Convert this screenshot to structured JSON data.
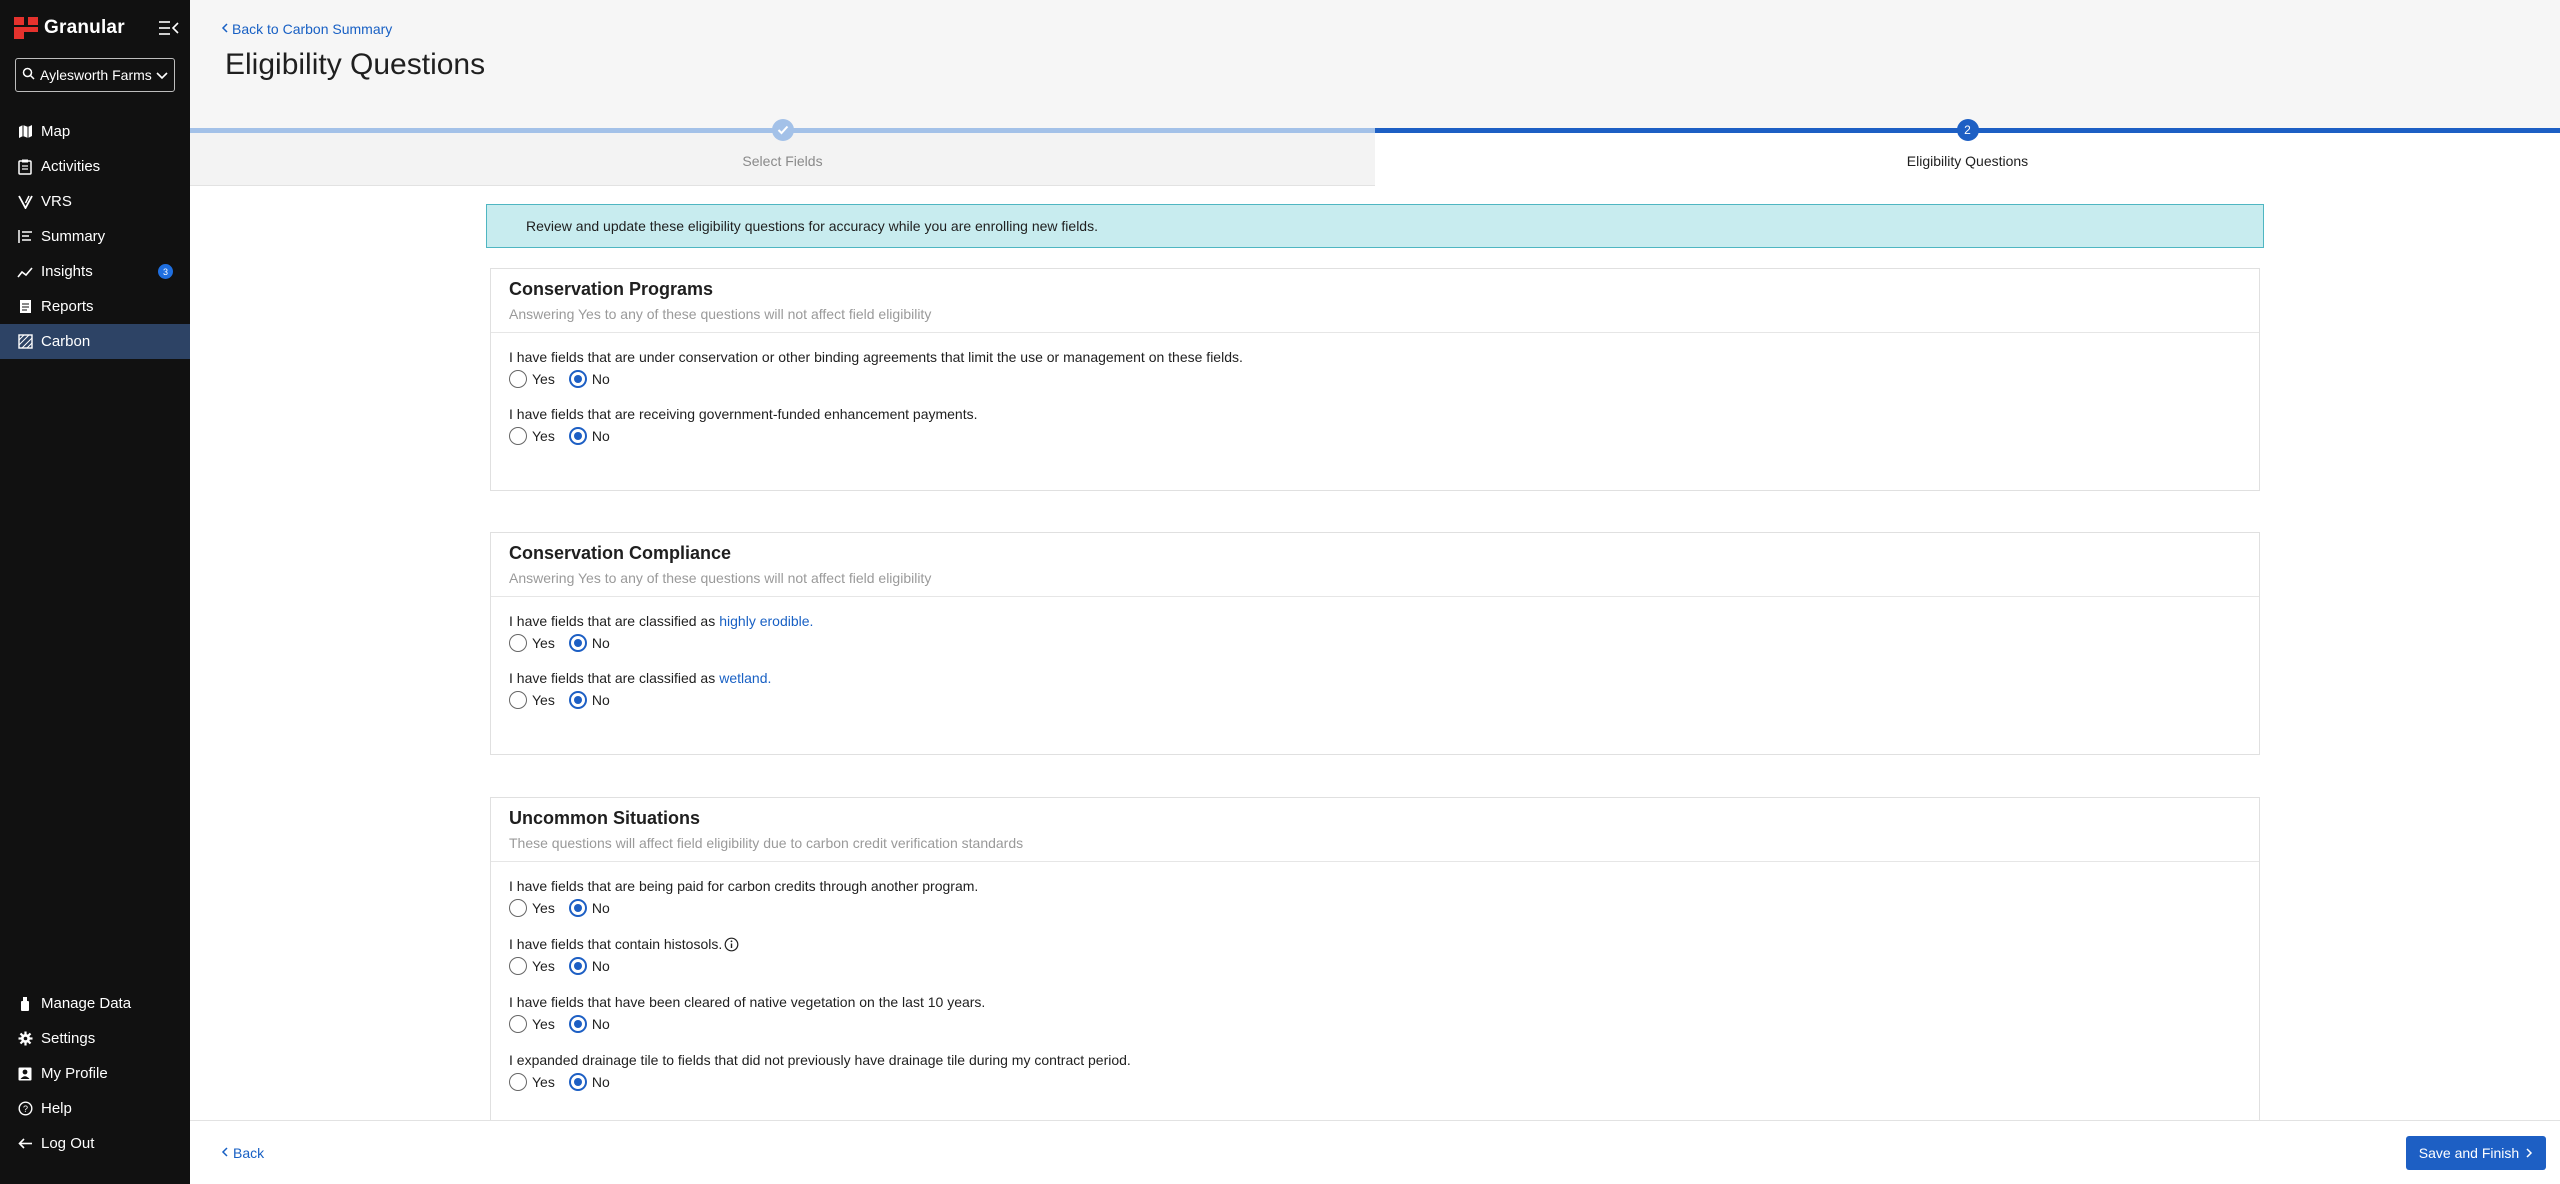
{
  "sidebar": {
    "brand": "Granular",
    "farm_selector": "Aylesworth Farms",
    "items": [
      {
        "label": "Map",
        "icon": "map-icon"
      },
      {
        "label": "Activities",
        "icon": "clipboard-icon"
      },
      {
        "label": "VRS",
        "icon": "vrs-icon"
      },
      {
        "label": "Summary",
        "icon": "summary-icon"
      },
      {
        "label": "Insights",
        "icon": "trend-icon",
        "badge": "3"
      },
      {
        "label": "Reports",
        "icon": "report-icon"
      },
      {
        "label": "Carbon",
        "icon": "carbon-icon",
        "active": true
      }
    ],
    "bottom_items": [
      {
        "label": "Manage Data",
        "icon": "database-icon"
      },
      {
        "label": "Settings",
        "icon": "gear-icon"
      },
      {
        "label": "My Profile",
        "icon": "profile-icon"
      },
      {
        "label": "Help",
        "icon": "help-icon"
      },
      {
        "label": "Log Out",
        "icon": "logout-icon"
      }
    ]
  },
  "header": {
    "back_label": "Back to Carbon Summary",
    "title": "Eligibility Questions"
  },
  "stepper": {
    "steps": [
      {
        "number": "",
        "label": "Select Fields",
        "state": "complete"
      },
      {
        "number": "2",
        "label": "Eligibility Questions",
        "state": "current"
      }
    ]
  },
  "banner": "Review and update these eligibility questions for accuracy while you are enrolling new fields.",
  "radio_labels": {
    "yes": "Yes",
    "no": "No"
  },
  "sections": [
    {
      "title": "Conservation Programs",
      "subtitle": "Answering Yes to any of these questions will not affect field eligibility",
      "questions": [
        {
          "text": "I have fields that are under conservation or other binding agreements that limit the use or management on these fields.",
          "answer": "No"
        },
        {
          "text": "I have fields that are receiving government-funded enhancement payments.",
          "answer": "No"
        }
      ]
    },
    {
      "title": "Conservation Compliance",
      "subtitle": "Answering Yes to any of these questions will not affect field eligibility",
      "questions": [
        {
          "text": "I have fields that are classified as",
          "link": "highly erodible.",
          "answer": "No"
        },
        {
          "text": "I have fields that are classified as",
          "link": "wetland.",
          "answer": "No"
        }
      ]
    },
    {
      "title": "Uncommon Situations",
      "subtitle": "These questions will affect field eligibility due to carbon credit verification standards",
      "questions": [
        {
          "text": "I have fields that are being paid for carbon credits through another program.",
          "answer": "No"
        },
        {
          "text": "I have fields that contain histosols.",
          "info": true,
          "answer": "No"
        },
        {
          "text": "I have fields that have been cleared of native vegetation on the last 10 years.",
          "answer": "No"
        },
        {
          "text": "I expanded drainage tile to fields that did not previously have drainage tile during my contract period.",
          "answer": "No"
        }
      ]
    }
  ],
  "footer": {
    "back_label": "Back",
    "save_label": "Save and Finish"
  },
  "colors": {
    "sidebar_bg": "#111111",
    "active_nav": "#2d4365",
    "primary": "#1d5fc4",
    "link": "#1860c4",
    "banner_bg": "#c8ecef",
    "brand_red": "#e5322d"
  }
}
